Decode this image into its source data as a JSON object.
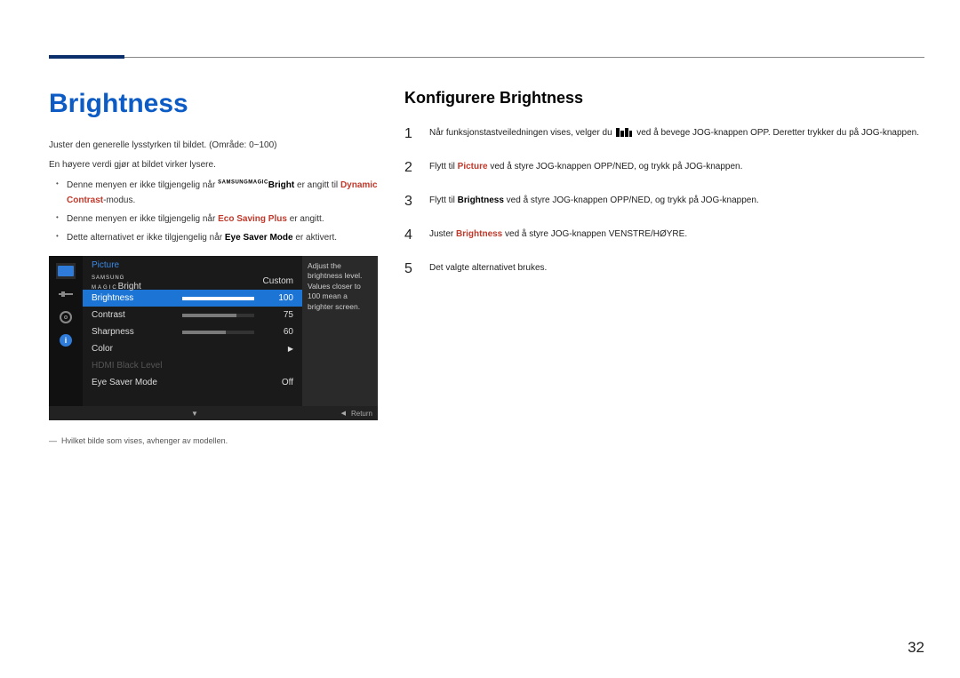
{
  "left": {
    "heading": "Brightness",
    "p1": "Juster den generelle lysstyrken til bildet. (Område: 0~100)",
    "p2": "En høyere verdi gjør at bildet virker lysere.",
    "b1a": "Denne menyen er ikke tilgjengelig når ",
    "magic_small": "SAMSUNG",
    "magic_big": "MAGIC",
    "b1b": "Bright",
    "b1c": " er angitt til ",
    "b1d": "Dynamic Contrast",
    "b1e": "-modus.",
    "b2a": "Denne menyen er ikke tilgjengelig når ",
    "b2b": "Eco Saving Plus",
    "b2c": " er angitt.",
    "b3a": "Dette alternativet er ikke tilgjengelig når ",
    "b3b": "Eye Saver Mode",
    "b3c": " er aktivert.",
    "footnote": "Hvilket bilde som vises, avhenger av modellen."
  },
  "osd": {
    "title": "Picture",
    "row_magic_prefix": "SAMSUNG",
    "row_magic_main": "MAGIC",
    "row_magic_suffix": "Bright",
    "custom": "Custom",
    "rows": [
      {
        "label": "Brightness",
        "value": "100",
        "pct": 100
      },
      {
        "label": "Contrast",
        "value": "75",
        "pct": 75
      },
      {
        "label": "Sharpness",
        "value": "60",
        "pct": 60
      }
    ],
    "color": "Color",
    "hdmi": "HDMI Black Level",
    "eyesaver": "Eye Saver Mode",
    "eyesaver_val": "Off",
    "desc": "Adjust the brightness level. Values closer to 100 mean a brighter screen.",
    "return": "Return"
  },
  "right": {
    "heading": "Konfigurere Brightness",
    "s1a": "Når funksjonstastveiledningen vises, velger du ",
    "s1b": " ved å bevege JOG-knappen OPP. Deretter trykker du på JOG-knappen.",
    "s2a": "Flytt til ",
    "s2b": "Picture",
    "s2c": " ved å styre JOG-knappen OPP/NED, og trykk på JOG-knappen.",
    "s3a": "Flytt til ",
    "s3b": "Brightness",
    "s3c": " ved å styre JOG-knappen OPP/NED, og trykk på JOG-knappen.",
    "s4a": "Juster ",
    "s4b": "Brightness",
    "s4c": " ved å styre JOG-knappen VENSTRE/HØYRE.",
    "s5": "Det valgte alternativet brukes."
  },
  "page_number": "32"
}
